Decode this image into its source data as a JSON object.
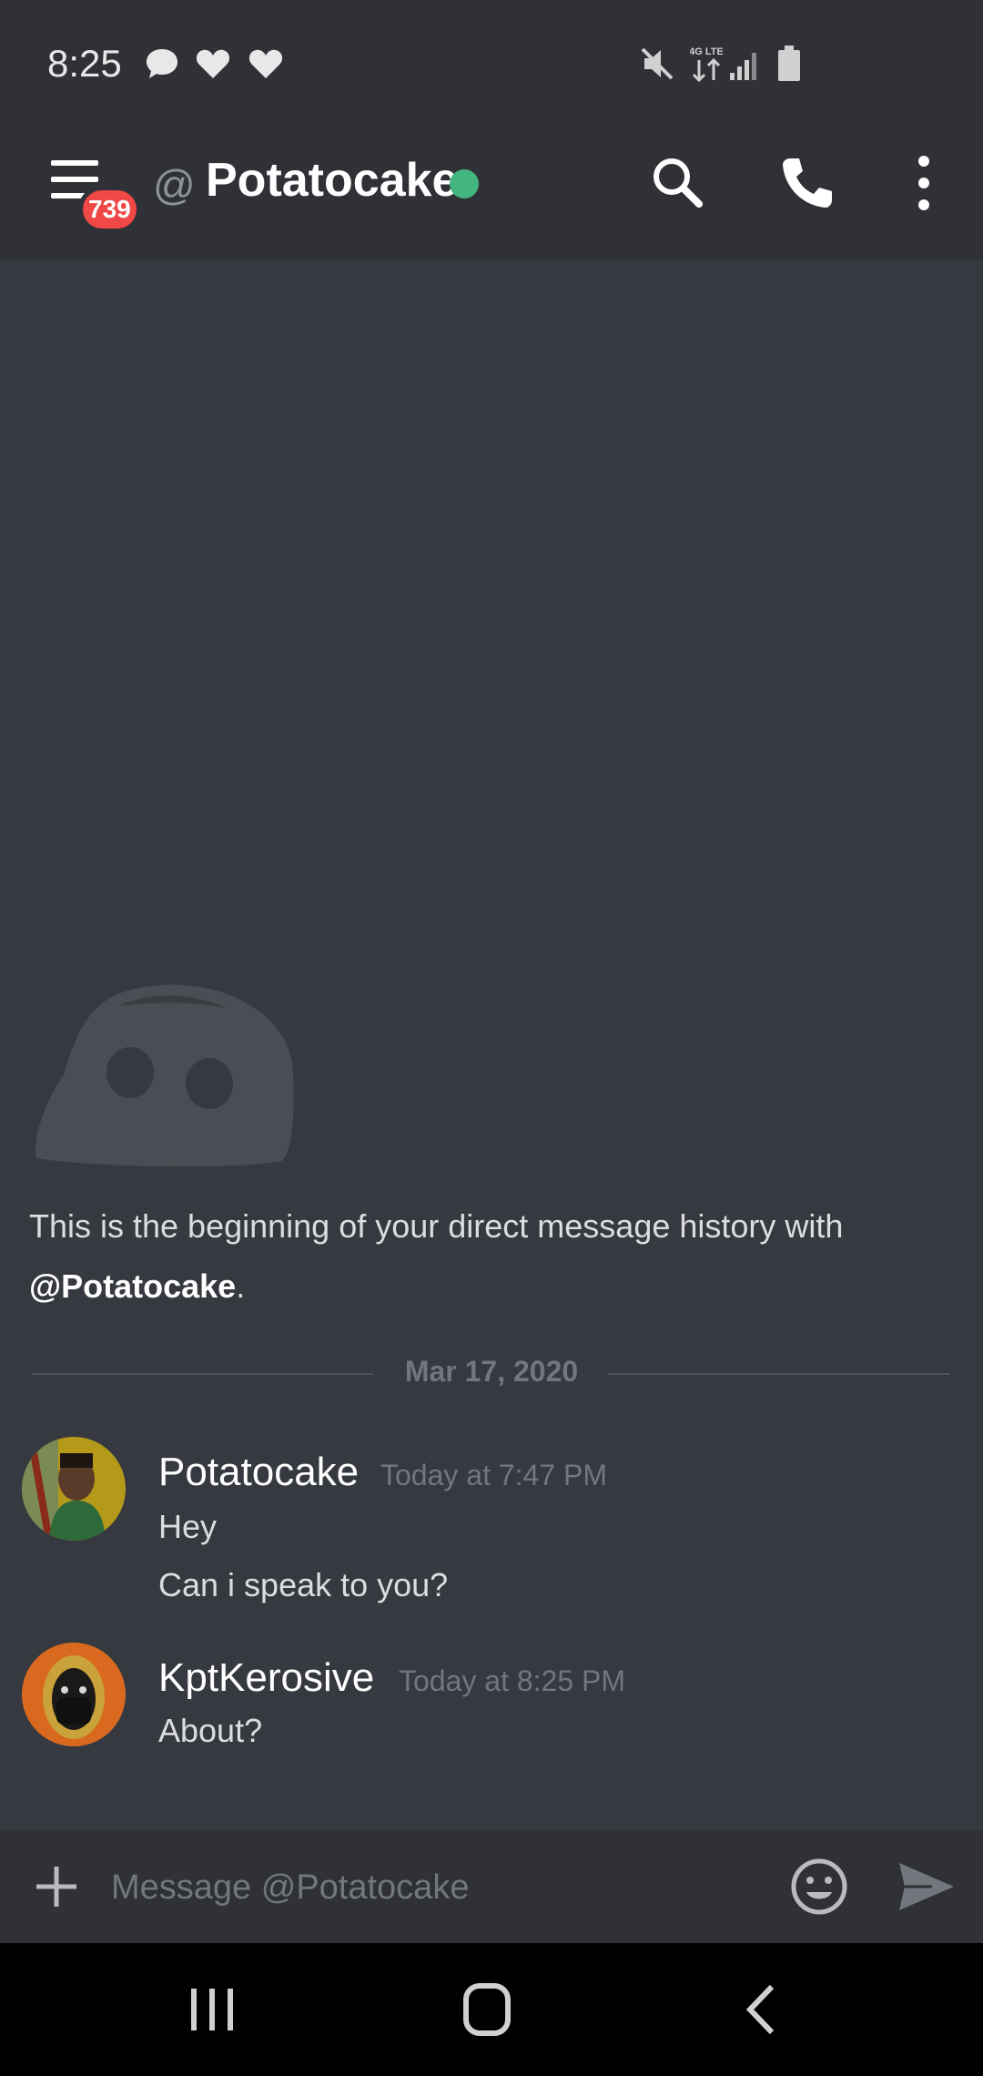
{
  "status_bar": {
    "time": "8:25",
    "left_icons": [
      "message-bubble-icon",
      "heart-icon",
      "heart-icon"
    ],
    "right_icons": [
      "mute-icon",
      "4g-lte-icon",
      "signal-icon",
      "battery-icon"
    ],
    "network_label": "4G LTE"
  },
  "header": {
    "menu_icon": "hamburger-menu-icon",
    "badge_count": "739",
    "at_sign": "@",
    "title": "Potatocake",
    "presence_icon": "online-dot",
    "actions": [
      "search-icon",
      "phone-icon",
      "more-vertical-icon"
    ]
  },
  "chat": {
    "intro_text": "This is the beginning of your direct message history with ",
    "intro_mention": "@Potatocake",
    "intro_suffix": ".",
    "date_divider": "Mar 17, 2020",
    "messages": [
      {
        "author": "Potatocake",
        "timestamp": "Today at 7:47 PM",
        "lines": [
          "Hey",
          "Can i speak to you?"
        ]
      },
      {
        "author": "KptKerosive",
        "timestamp": "Today at 8:25 PM",
        "lines": [
          "About?"
        ]
      }
    ]
  },
  "composer": {
    "placeholder": "Message @Potatocake",
    "value": "",
    "icons": [
      "plus-icon",
      "emoji-icon",
      "send-icon"
    ]
  },
  "nav_bar": {
    "icons": [
      "recents-icon",
      "home-icon",
      "back-icon"
    ]
  },
  "colors": {
    "background": "#36393f",
    "bar": "#2f3136",
    "online": "#43b581",
    "badge": "#f04747",
    "muted_text": "#72767d"
  }
}
